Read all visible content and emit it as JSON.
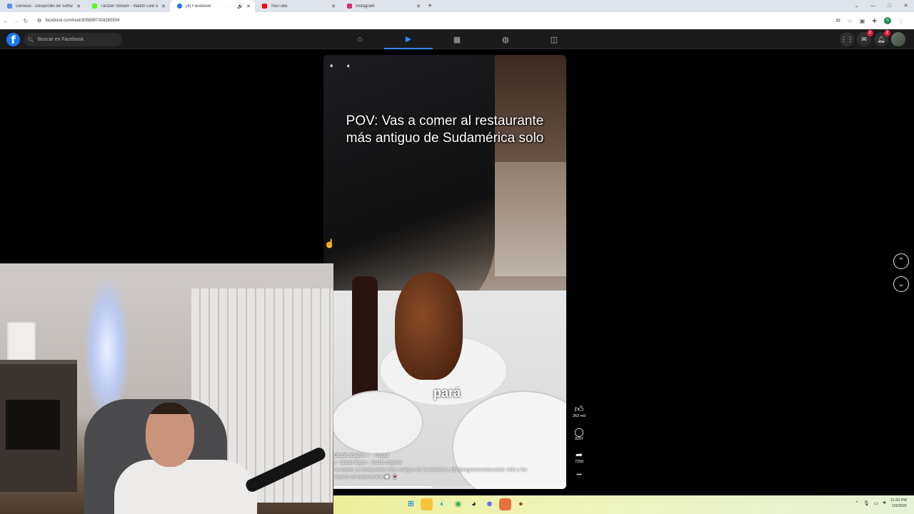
{
  "browser": {
    "tabs": [
      {
        "title": "Génesis - Desarrollo de Software",
        "favicon_color": "#5a8dee",
        "active": false
      },
      {
        "title": "Tarizen Stream - Watch Live or",
        "favicon_color": "#53fc18",
        "active": false
      },
      {
        "title": "(4) Facebook",
        "favicon_color": "#1877f2",
        "active": true
      },
      {
        "title": "YouTube",
        "favicon_color": "#ff0000",
        "active": false
      },
      {
        "title": "Instagram",
        "favicon_color": "#d62976",
        "active": false
      }
    ],
    "new_tab": "+",
    "url": "facebook.com/reel/3058997304280504",
    "profile_initial": "S"
  },
  "facebook": {
    "logo": "f",
    "search_placeholder": "Buscar en Facebook",
    "nav_icons": [
      "home-icon",
      "video-icon",
      "marketplace-icon",
      "groups-icon",
      "gaming-icon"
    ],
    "messenger_badge": "2",
    "notifications_badge": "2",
    "accent": "#2d88ff"
  },
  "reel": {
    "caption_line1": "POV: Vas a comer al restaurante",
    "caption_line2": "más antiguo de Sudamérica solo",
    "subtitle": "pará",
    "author": "Clubb Bajon",
    "follow": "· Seguir",
    "audio": "♬ Clubb Bajon · Audio original",
    "description_line1": "i a comer al restaurante más antiguo de Sudamérica @elprogresorestaurante solo y les",
    "description_line2": "mparto mi experiencia 🍽️ 🍷",
    "progress": 0.42,
    "likes": "262 mil",
    "comments": "3257",
    "shares": "7259",
    "more": "•••"
  },
  "taskbar": {
    "time": "11:20 PM",
    "date": "1/9/2026"
  }
}
